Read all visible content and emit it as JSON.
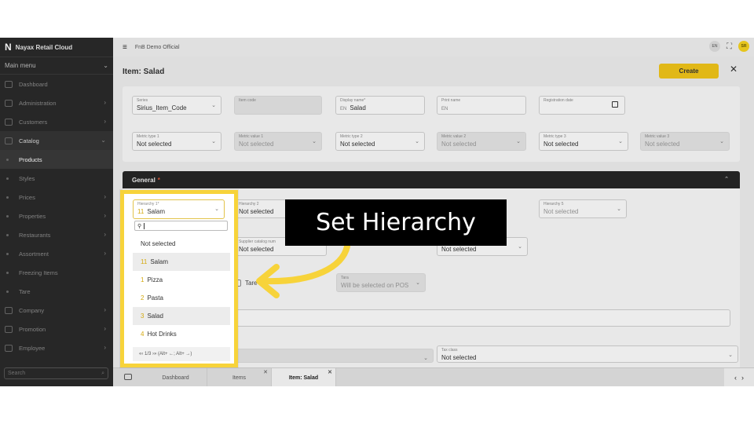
{
  "sidebar": {
    "brand": "Nayax Retail Cloud",
    "main_menu": "Main menu",
    "items": [
      {
        "label": "Dashboard",
        "kind": "icon"
      },
      {
        "label": "Administration",
        "kind": "icon",
        "has_chevron": true
      },
      {
        "label": "Customers",
        "kind": "icon",
        "has_chevron": true
      },
      {
        "label": "Catalog",
        "kind": "icon",
        "expanded": true
      },
      {
        "label": "Products",
        "kind": "sub",
        "active": true
      },
      {
        "label": "Styles",
        "kind": "sub"
      },
      {
        "label": "Prices",
        "kind": "sub",
        "has_chevron": true
      },
      {
        "label": "Properties",
        "kind": "sub",
        "has_chevron": true
      },
      {
        "label": "Restaurants",
        "kind": "sub",
        "has_chevron": true
      },
      {
        "label": "Assortment",
        "kind": "sub",
        "has_chevron": true
      },
      {
        "label": "Freezing Items",
        "kind": "sub"
      },
      {
        "label": "Tare",
        "kind": "sub"
      },
      {
        "label": "Company",
        "kind": "icon",
        "has_chevron": true
      },
      {
        "label": "Promotion",
        "kind": "icon",
        "has_chevron": true
      },
      {
        "label": "Employee",
        "kind": "icon",
        "has_chevron": true
      }
    ],
    "search_placeholder": "Search"
  },
  "topbar": {
    "org": "FnB Demo Official",
    "lang": "EN",
    "avatar": "SR"
  },
  "page": {
    "title": "Item: Salad",
    "create_label": "Create"
  },
  "fields_row1": [
    {
      "label": "Series",
      "value": "Sirius_Item_Code",
      "chevron": true
    },
    {
      "label": "Item code",
      "value": "",
      "disabled": true
    },
    {
      "label": "Display name*",
      "prefix": "EN",
      "value": "Salad"
    },
    {
      "label": "Print name",
      "prefix": "EN",
      "value": ""
    },
    {
      "label": "Registration date",
      "value": "",
      "calendar": true
    }
  ],
  "fields_row2": [
    {
      "label": "Metric type 1",
      "value": "Not selected"
    },
    {
      "label": "Metric value 1",
      "value": "Not selected",
      "disabled": true
    },
    {
      "label": "Metric type 2",
      "value": "Not selected"
    },
    {
      "label": "Metric value 2",
      "value": "Not selected",
      "disabled": true
    },
    {
      "label": "Metric type 3",
      "value": "Not selected"
    },
    {
      "label": "Metric value 3",
      "value": "Not selected",
      "disabled": true
    }
  ],
  "general": {
    "title": "General",
    "required_mark": "*",
    "hierarchy2_label": "Hierarchy 2",
    "hierarchy2_value": "Not selected",
    "hierarchy5_label": "Hierarchy 5",
    "hierarchy5_value": "Not selected",
    "supplier_label": "Supplier catalog num",
    "supplier_value": "Not selected",
    "field_b_value": "Not selected",
    "tare_label": "Tare",
    "tara_label": "Tara",
    "tara_value": "Will be selected on POS",
    "tax_label": "Tax class",
    "tax_value": "Not selected"
  },
  "dropdown": {
    "field_label": "Hierarchy 1*",
    "field_code": "11",
    "field_value": "Salam",
    "search_value": "",
    "options": [
      {
        "code": "",
        "label": "Not selected"
      },
      {
        "code": "11",
        "label": "Salam",
        "highlight": true
      },
      {
        "code": "1",
        "label": "Pizza"
      },
      {
        "code": "2",
        "label": "Pasta"
      },
      {
        "code": "3",
        "label": "Salad",
        "highlight": true
      },
      {
        "code": "4",
        "label": "Hot Drinks"
      }
    ],
    "footer": "«‹ 1/3 ›» (Alt+ ←; Alt+ →)"
  },
  "tabs": [
    {
      "label": "Dashboard"
    },
    {
      "label": "Items",
      "closable": true
    },
    {
      "label": "Item: Salad",
      "closable": true,
      "active": true
    }
  ],
  "callout": {
    "text": "Set Hierarchy"
  },
  "colors": {
    "accent": "#f0c419",
    "frame": "#f7d33a",
    "sidebar": "#2a2a2a"
  }
}
